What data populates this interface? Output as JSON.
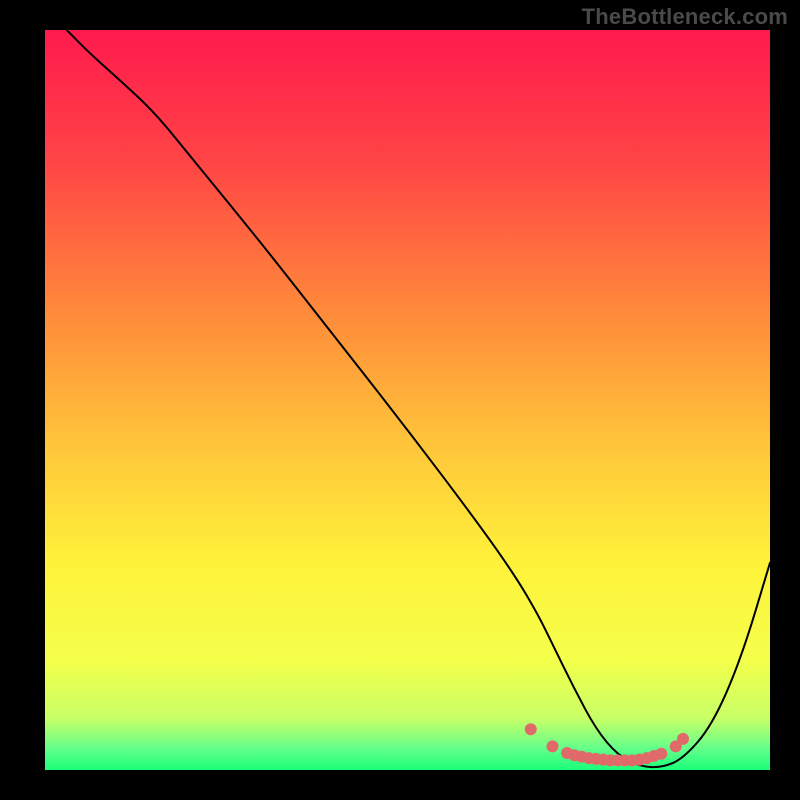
{
  "watermark": "TheBottleneck.com",
  "chart_data": {
    "type": "line",
    "title": "",
    "xlabel": "",
    "ylabel": "",
    "xlim": [
      0,
      100
    ],
    "ylim": [
      0,
      100
    ],
    "grid": false,
    "background_gradient": {
      "orientation": "vertical",
      "stops": [
        {
          "offset": 0.0,
          "color": "#ff1a4d"
        },
        {
          "offset": 0.18,
          "color": "#ff4545"
        },
        {
          "offset": 0.38,
          "color": "#ff8a3a"
        },
        {
          "offset": 0.55,
          "color": "#ffc23a"
        },
        {
          "offset": 0.72,
          "color": "#fff23a"
        },
        {
          "offset": 0.85,
          "color": "#f4ff4a"
        },
        {
          "offset": 0.93,
          "color": "#c8ff66"
        },
        {
          "offset": 0.97,
          "color": "#66ff8a"
        },
        {
          "offset": 1.0,
          "color": "#1aff7a"
        }
      ]
    },
    "series": [
      {
        "name": "bottleneck-curve",
        "color": "#000000",
        "stroke_width": 2,
        "x": [
          3,
          6,
          10,
          15,
          20,
          30,
          40,
          50,
          60,
          65,
          68,
          70,
          73,
          76,
          79,
          82,
          85,
          88,
          92,
          96,
          100
        ],
        "values": [
          100,
          97,
          93.5,
          89,
          83,
          71,
          58.5,
          46,
          33,
          26,
          21,
          17,
          11,
          5.5,
          2,
          0.5,
          0.3,
          1.5,
          6,
          15,
          28
        ]
      }
    ],
    "markers": {
      "name": "flat-region-dots",
      "color": "#e06a6a",
      "radius": 6,
      "x": [
        67,
        70,
        72,
        73,
        74,
        75,
        76,
        77,
        78,
        79,
        80,
        81,
        82,
        83,
        84,
        85,
        87,
        88
      ],
      "values": [
        5.5,
        3.2,
        2.3,
        2.0,
        1.8,
        1.6,
        1.5,
        1.4,
        1.3,
        1.3,
        1.3,
        1.3,
        1.4,
        1.6,
        1.9,
        2.2,
        3.2,
        4.2
      ]
    },
    "annotations": []
  }
}
